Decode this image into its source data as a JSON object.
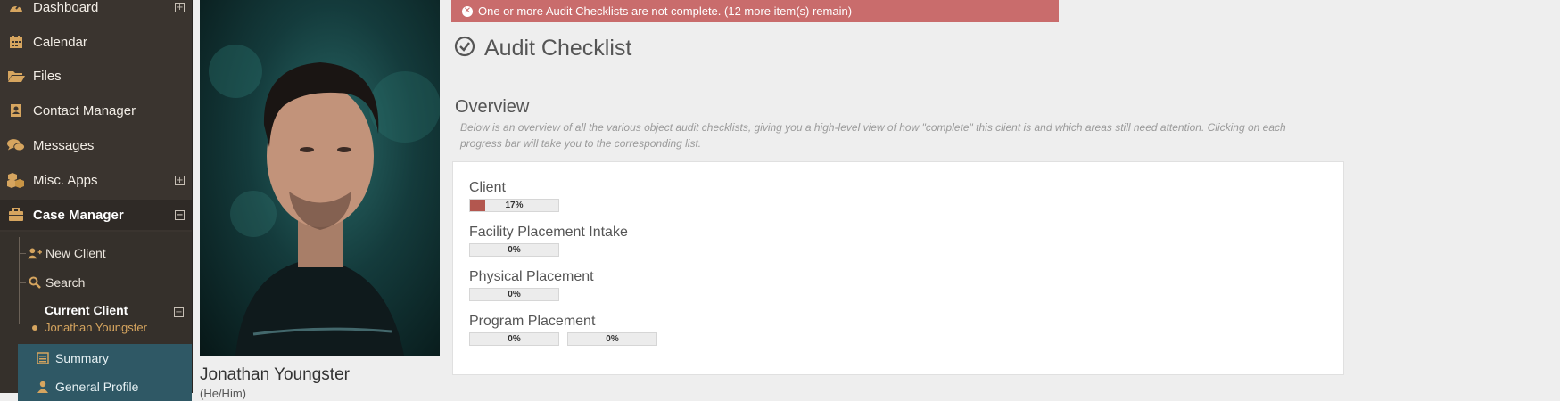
{
  "sidebar": {
    "items": [
      {
        "label": "Dashboard",
        "icon": "dashboard-icon",
        "expand": "+"
      },
      {
        "label": "Calendar",
        "icon": "calendar-icon"
      },
      {
        "label": "Files",
        "icon": "folder-icon"
      },
      {
        "label": "Contact Manager",
        "icon": "address-book-icon"
      },
      {
        "label": "Messages",
        "icon": "chat-icon"
      },
      {
        "label": "Misc. Apps",
        "icon": "cubes-icon",
        "expand": "+"
      },
      {
        "label": "Case Manager",
        "icon": "briefcase-icon",
        "expand": "−"
      }
    ],
    "case_manager_sub": [
      {
        "label": "New Client",
        "icon": "user-plus-icon"
      },
      {
        "label": "Search",
        "icon": "search-icon"
      }
    ],
    "current_client": {
      "label": "Current Client",
      "expand": "−",
      "name": "Jonathan Youngster"
    },
    "client_menu": [
      {
        "label": "Summary",
        "icon": "list-icon"
      },
      {
        "label": "General Profile",
        "icon": "user-icon"
      }
    ]
  },
  "client": {
    "name": "Jonathan Youngster",
    "pronouns": "(He/Him)"
  },
  "alert": {
    "text": "One or more Audit Checklists are not complete. (12 more item(s) remain)",
    "icon": "close-circle-icon"
  },
  "page": {
    "title": "Audit Checklist",
    "icon": "check-circle-icon"
  },
  "overview": {
    "title": "Overview",
    "description": "Below is an overview of all the various object audit checklists, giving you a high-level view of how \"complete\" this client is and which areas still need attention. Clicking on each progress bar will take you to the corresponding list."
  },
  "checklists": [
    {
      "label": "Client",
      "bars": [
        {
          "percent": 17,
          "text": "17%"
        }
      ]
    },
    {
      "label": "Facility Placement Intake",
      "bars": [
        {
          "percent": 0,
          "text": "0%"
        }
      ]
    },
    {
      "label": "Physical Placement",
      "bars": [
        {
          "percent": 0,
          "text": "0%"
        }
      ]
    },
    {
      "label": "Program Placement",
      "bars": [
        {
          "percent": 0,
          "text": "0%"
        },
        {
          "percent": 0,
          "text": "0%"
        }
      ]
    }
  ],
  "colors": {
    "sidebar": "#3a342f",
    "accent": "#d6a55f",
    "alert": "#c96c6c",
    "progress_fill": "#b3574f",
    "teal": "#2f5865"
  }
}
